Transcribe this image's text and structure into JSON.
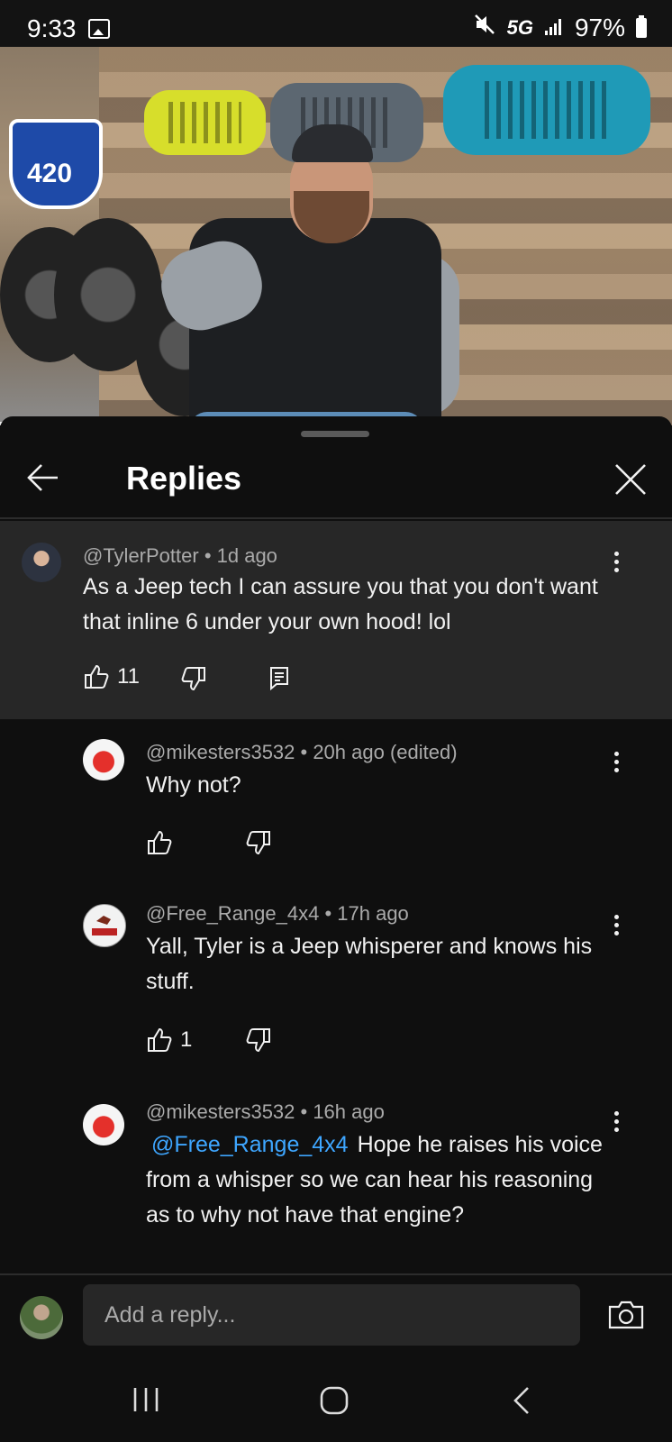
{
  "status_bar": {
    "time": "9:33",
    "network": "5G",
    "battery": "97%"
  },
  "sheet": {
    "title": "Replies"
  },
  "comments": [
    {
      "meta": "@TylerPotter • 1d ago",
      "text": "As a Jeep tech I can assure you that you don't want that inline 6 under your own hood! lol",
      "likes": "11"
    },
    {
      "meta": "@mikesters3532 • 20h ago (edited)",
      "text": "Why not?",
      "likes": ""
    },
    {
      "meta": "@Free_Range_4x4 • 17h ago",
      "text": "Yall, Tyler is a Jeep whisperer and knows his stuff.",
      "likes": "1"
    },
    {
      "meta": "@mikesters3532 • 16h ago",
      "mention": "@Free_Range_4x4",
      "text": "Hope he raises his voice from a whisper so we can hear his reasoning as to why not have that engine?"
    }
  ],
  "composer": {
    "placeholder": "Add a reply..."
  },
  "colors": {
    "background": "#0f0f0f",
    "highlight": "#272727",
    "mention": "#3ea6ff",
    "meta_text": "#aaaaaa"
  },
  "icons": [
    "image-icon",
    "mute-icon",
    "signal-icon",
    "battery-icon",
    "back-arrow-icon",
    "close-icon",
    "kebab-icon",
    "like-icon",
    "dislike-icon",
    "reply-icon",
    "camera-icon",
    "recents-icon",
    "home-icon",
    "back-icon"
  ]
}
